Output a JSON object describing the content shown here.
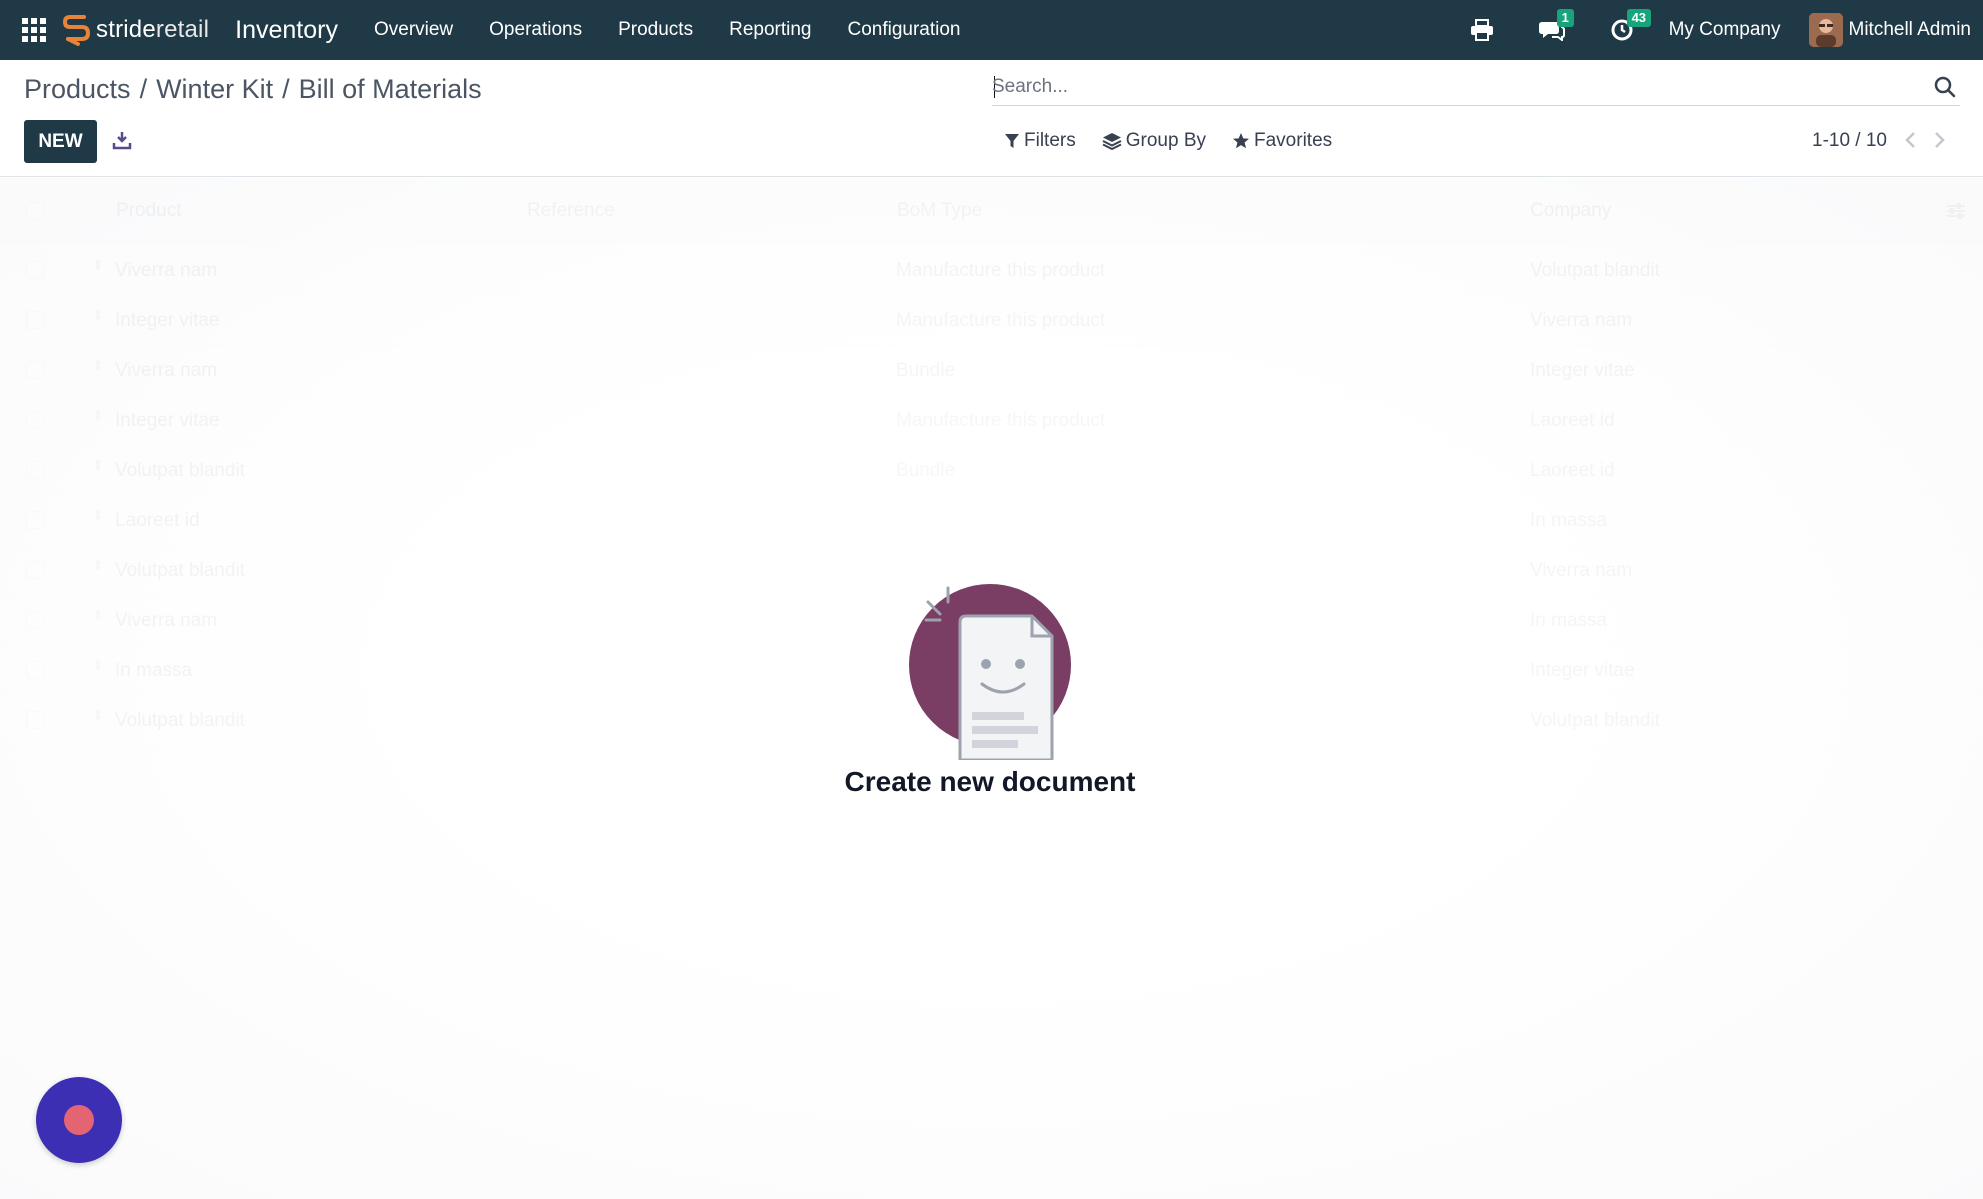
{
  "navbar": {
    "brand_part1": "stride",
    "brand_part2": "retail",
    "app_name": "Inventory",
    "menu": [
      "Overview",
      "Operations",
      "Products",
      "Reporting",
      "Configuration"
    ],
    "messages_badge": "1",
    "activities_badge": "43",
    "company": "My Company",
    "user_name": "Mitchell Admin",
    "colors": {
      "background": "#1f3a46",
      "badge": "#17a47a"
    }
  },
  "control_panel": {
    "breadcrumb": [
      "Products",
      "Winter Kit",
      "Bill of Materials"
    ],
    "breadcrumb_sep": "/",
    "new_label": "NEW",
    "search": {
      "placeholder": "Search..."
    },
    "filters_label": "Filters",
    "group_by_label": "Group By",
    "favorites_label": "Favorites",
    "pager": "1-10 / 10"
  },
  "list": {
    "columns": [
      "Product",
      "Reference",
      "BoM Type",
      "Company"
    ],
    "rows": [
      {
        "product": "Viverra nam",
        "reference": "",
        "bom_type": "Manufacture this product",
        "company": "Volutpat blandit"
      },
      {
        "product": "Integer vitae",
        "reference": "",
        "bom_type": "Manufacture this product",
        "company": "Viverra nam"
      },
      {
        "product": "Viverra nam",
        "reference": "",
        "bom_type": "Bundle",
        "company": "Integer vitae"
      },
      {
        "product": "Integer vitae",
        "reference": "",
        "bom_type": "Manufacture this product",
        "company": "Laoreet id"
      },
      {
        "product": "Volutpat blandit",
        "reference": "",
        "bom_type": "Bundle",
        "company": "Laoreet id"
      },
      {
        "product": "Laoreet id",
        "reference": "",
        "bom_type": "",
        "company": "In massa"
      },
      {
        "product": "Volutpat blandit",
        "reference": "",
        "bom_type": "",
        "company": "Viverra nam"
      },
      {
        "product": "Viverra nam",
        "reference": "",
        "bom_type": "",
        "company": "In massa"
      },
      {
        "product": "In massa",
        "reference": "",
        "bom_type": "",
        "company": "Integer vitae"
      },
      {
        "product": "Volutpat blandit",
        "reference": "",
        "bom_type": "",
        "company": "Volutpat blandit"
      }
    ]
  },
  "empty_state": {
    "title": "Create new document",
    "colors": {
      "circle": "#7a3d64",
      "paper": "#f3f4f6",
      "outline": "#9ca3af"
    }
  },
  "fab": {
    "colors": {
      "outer": "#3c2fb3",
      "inner": "#e56473"
    }
  }
}
